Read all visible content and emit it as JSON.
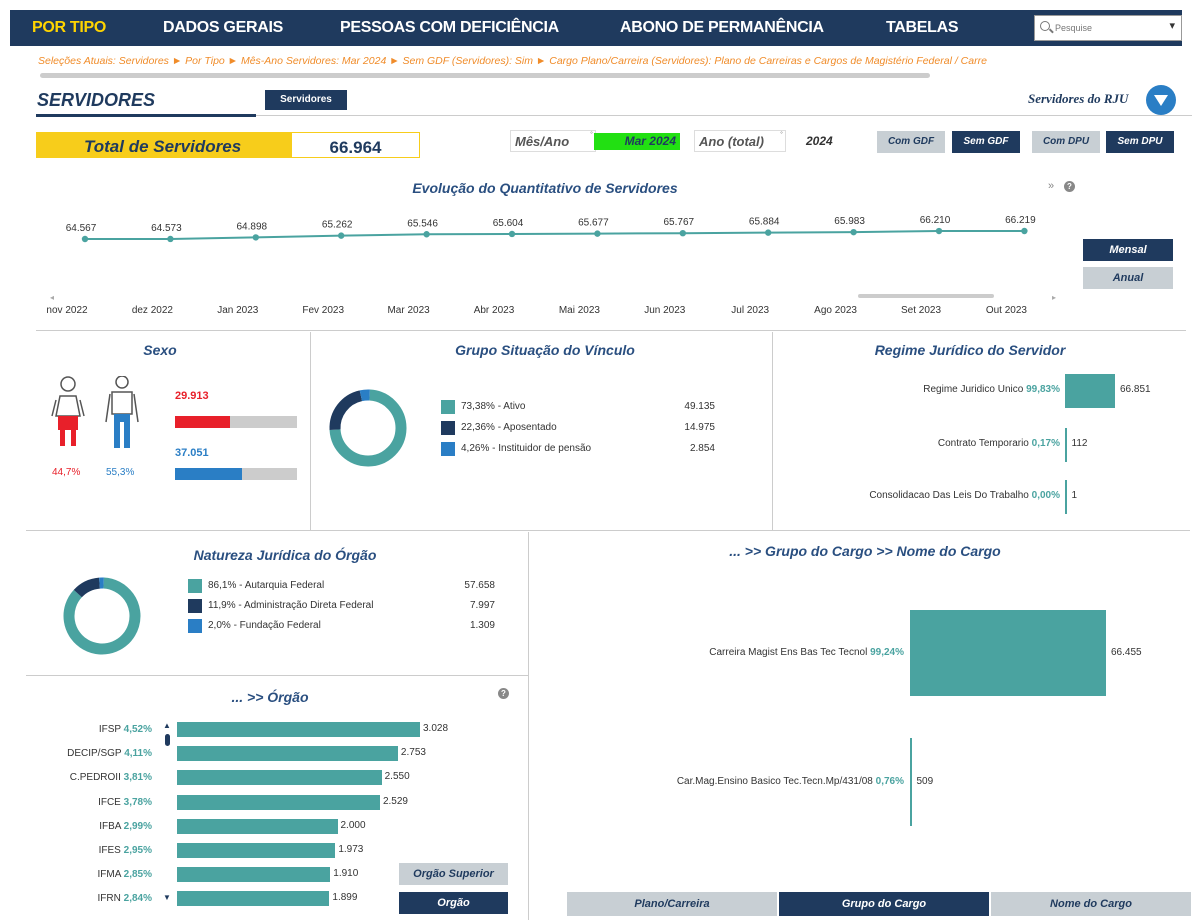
{
  "nav": {
    "items": [
      "POR TIPO",
      "DADOS GERAIS",
      "PESSOAS COM DEFICIÊNCIA",
      "ABONO DE PERMANÊNCIA",
      "TABELAS"
    ],
    "search_placeholder": "Pesquise"
  },
  "breadcrumb": "Seleções Atuais: Servidores ► Por Tipo ► Mês-Ano Servidores: Mar 2024 ► Sem GDF (Servidores): Sim ► Cargo Plano/Carreira (Servidores): Plano de Carreiras e Cargos de Magistério Federal / Carre",
  "header": {
    "title": "SERVIDORES",
    "tab": "Servidores",
    "rju_link": "Servidores do RJU"
  },
  "total": {
    "label": "Total de Servidores",
    "value": "66.964"
  },
  "filters": {
    "mes_ano_label": "Mês/Ano",
    "mes_ano_value": "Mar 2024",
    "ano_label": "Ano (total)",
    "ano_value": "2024",
    "com_gdf": "Com GDF",
    "sem_gdf": "Sem GDF",
    "com_dpu": "Com DPU",
    "sem_dpu": "Sem DPU"
  },
  "evolucao": {
    "title": "Evolução do Quantitativo de Servidores",
    "more": "»",
    "mensal": "Mensal",
    "anual": "Anual"
  },
  "sexo": {
    "title": "Sexo",
    "fem_value": "29.913",
    "masc_value": "37.051",
    "fem_pct": "44,7%",
    "masc_pct": "55,3%",
    "fem_fraction": 0.447,
    "masc_fraction": 0.553,
    "fem_color": "#e8202a",
    "masc_color": "#2a7ec5"
  },
  "vinculo": {
    "title": "Grupo Situação do Vínculo",
    "items": [
      {
        "label": "73,38% - Ativo",
        "value": "49.135",
        "color": "#4aa3a0"
      },
      {
        "label": "22,36% - Aposentado",
        "value": "14.975",
        "color": "#1f3a5e"
      },
      {
        "label": "4,26% - Instituidor de pensão",
        "value": "2.854",
        "color": "#2a7ec5"
      }
    ]
  },
  "regime": {
    "title": "Regime Jurídico do Servidor",
    "items": [
      {
        "name": "Regime Juridico Unico",
        "pct": "99,83%",
        "value": "66.851"
      },
      {
        "name": "Contrato Temporario",
        "pct": "0,17%",
        "value": "112"
      },
      {
        "name": "Consolidacao Das Leis Do Trabalho",
        "pct": "0,00%",
        "value": "1"
      }
    ]
  },
  "natureza": {
    "title": "Natureza Jurídica do Órgão",
    "items": [
      {
        "label": "86,1% - Autarquia Federal",
        "value": "57.658",
        "color": "#4aa3a0"
      },
      {
        "label": "11,9% - Administração Direta Federal",
        "value": "7.997",
        "color": "#1f3a5e"
      },
      {
        "label": "2,0% - Fundação Federal",
        "value": "1.309",
        "color": "#2a7ec5"
      }
    ]
  },
  "orgao": {
    "title": "... >> Órgão",
    "btn_superior": "Orgão Superior",
    "btn_orgao": "Orgão",
    "items": [
      {
        "name": "IFSP",
        "pct": "4,52%",
        "value": "3.028"
      },
      {
        "name": "DECIP/SGP",
        "pct": "4,11%",
        "value": "2.753"
      },
      {
        "name": "C.PEDROII",
        "pct": "3,81%",
        "value": "2.550"
      },
      {
        "name": "IFCE",
        "pct": "3,78%",
        "value": "2.529"
      },
      {
        "name": "IFBA",
        "pct": "2,99%",
        "value": "2.000"
      },
      {
        "name": "IFES",
        "pct": "2,95%",
        "value": "1.973"
      },
      {
        "name": "IFMA",
        "pct": "2,85%",
        "value": "1.910"
      },
      {
        "name": "IFRN",
        "pct": "2,84%",
        "value": "1.899"
      }
    ]
  },
  "cargo": {
    "title": "... >> Grupo do Cargo >> Nome do Cargo",
    "tabs": [
      "Plano/Carreira",
      "Grupo do Cargo",
      "Nome do Cargo"
    ],
    "items": [
      {
        "name": "Carreira Magist Ens Bas Tec Tecnol",
        "pct": "99,24%",
        "value": "66.455"
      },
      {
        "name": "Car.Mag.Ensino Basico Tec.Tecn.Mp/431/08",
        "pct": "0,76%",
        "value": "509"
      }
    ]
  },
  "chart_data": [
    {
      "type": "line",
      "title": "Evolução do Quantitativo de Servidores",
      "x": [
        "nov 2022",
        "dez 2022",
        "Jan 2023",
        "Fev 2023",
        "Mar 2023",
        "Abr 2023",
        "Mai 2023",
        "Jun 2023",
        "Jul 2023",
        "Ago 2023",
        "Set 2023",
        "Out 2023"
      ],
      "values": [
        64567,
        64573,
        64898,
        65262,
        65546,
        65604,
        65677,
        65767,
        65884,
        65983,
        66210,
        66219
      ],
      "labels": [
        "64.567",
        "64.573",
        "64.898",
        "65.262",
        "65.546",
        "65.604",
        "65.677",
        "65.767",
        "65.884",
        "65.983",
        "66.210",
        "66.219"
      ],
      "color": "#4aa3a0"
    },
    {
      "type": "pie",
      "title": "Grupo Situação do Vínculo",
      "categories": [
        "Ativo",
        "Aposentado",
        "Instituidor de pensão"
      ],
      "values": [
        73.38,
        22.36,
        4.26
      ]
    },
    {
      "type": "pie",
      "title": "Natureza Jurídica do Órgão",
      "categories": [
        "Autarquia Federal",
        "Administração Direta Federal",
        "Fundação Federal"
      ],
      "values": [
        86.1,
        11.9,
        2.0
      ]
    },
    {
      "type": "bar",
      "title": "Regime Jurídico do Servidor",
      "categories": [
        "Regime Juridico Unico",
        "Contrato Temporario",
        "Consolidacao Das Leis Do Trabalho"
      ],
      "values": [
        66851,
        112,
        1
      ]
    },
    {
      "type": "bar",
      "title": "... >> Órgão",
      "categories": [
        "IFSP",
        "DECIP/SGP",
        "C.PEDROII",
        "IFCE",
        "IFBA",
        "IFES",
        "IFMA",
        "IFRN"
      ],
      "values": [
        3028,
        2753,
        2550,
        2529,
        2000,
        1973,
        1910,
        1899
      ]
    },
    {
      "type": "bar",
      "title": "... >> Grupo do Cargo >> Nome do Cargo",
      "categories": [
        "Carreira Magist Ens Bas Tec Tecnol",
        "Car.Mag.Ensino Basico Tec.Tecn.Mp/431/08"
      ],
      "values": [
        66455,
        509
      ]
    }
  ]
}
